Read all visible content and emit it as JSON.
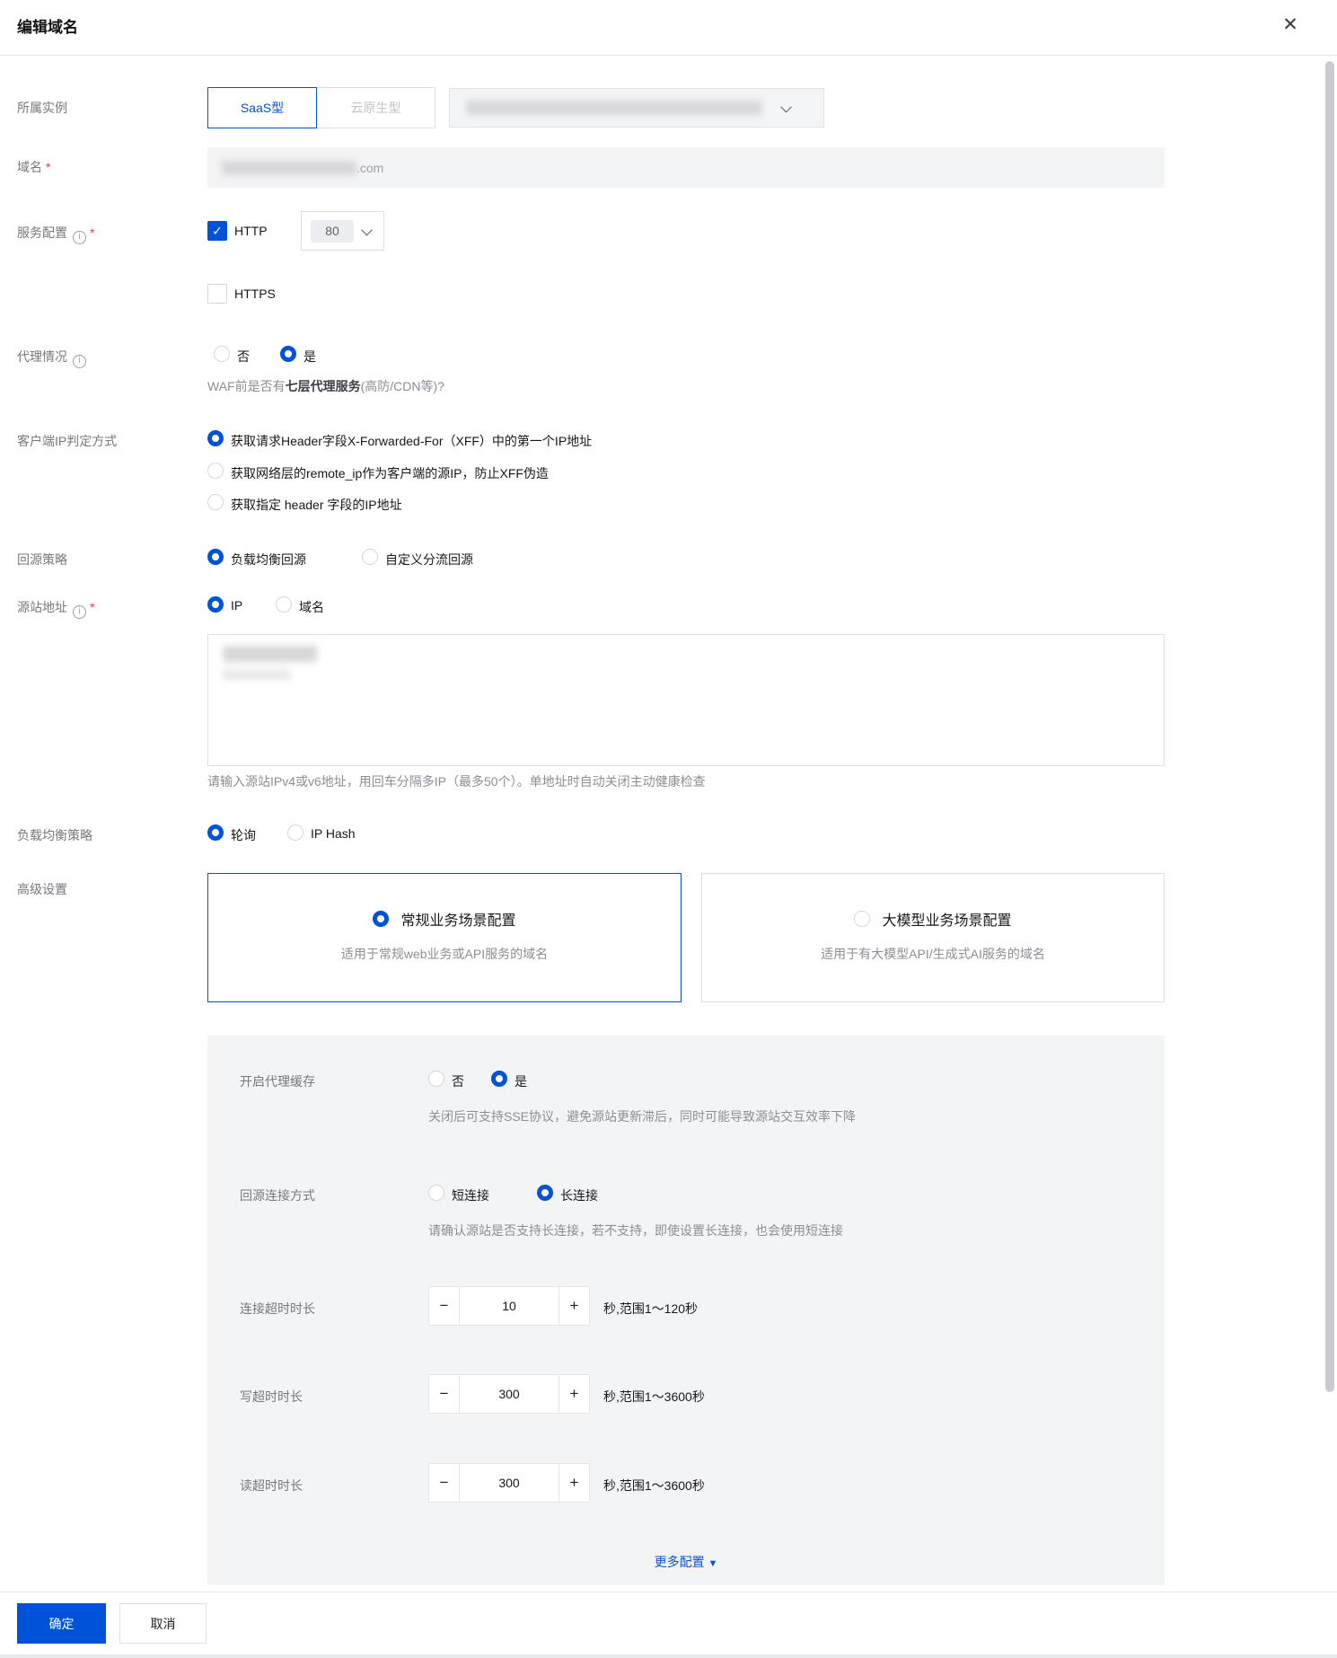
{
  "header": {
    "title": "编辑域名"
  },
  "icons": {
    "close": "✕",
    "check": "✓",
    "info": "i",
    "minus": "−",
    "plus": "+",
    "caret_down": "▼"
  },
  "required_mark": "*",
  "colors": {
    "primary": "#0052d9",
    "danger": "#e54545",
    "panel_bg": "#f3f4f6"
  },
  "form": {
    "instance": {
      "label": "所属实例",
      "tabs": [
        {
          "label": "SaaS型"
        },
        {
          "label": "云原生型"
        }
      ]
    },
    "domain": {
      "label": "域名",
      "suffix": ".com"
    },
    "service": {
      "label": "服务配置",
      "http": {
        "label": "HTTP",
        "port": "80"
      },
      "https": {
        "label": "HTTPS"
      }
    },
    "proxy": {
      "label": "代理情况",
      "no": "否",
      "yes": "是",
      "helper_prefix": "WAF前是否有",
      "helper_bold": "七层代理服务",
      "helper_suffix": "(高防/CDN等)?"
    },
    "client_ip": {
      "label": "客户端IP判定方式",
      "options": [
        "获取请求Header字段X-Forwarded-For（XFF）中的第一个IP地址",
        "获取网络层的remote_ip作为客户端的源IP，防止XFF伪造",
        "获取指定 header 字段的IP地址"
      ]
    },
    "origin_policy": {
      "label": "回源策略",
      "options": [
        "负载均衡回源",
        "自定义分流回源"
      ]
    },
    "origin_addr": {
      "label": "源站地址",
      "options": [
        "IP",
        "域名"
      ],
      "helper": "请输入源站IPv4或v6地址，用回车分隔多IP（最多50个）。单地址时自动关闭主动健康检查"
    },
    "lb": {
      "label": "负载均衡策略",
      "options": [
        "轮询",
        "IP Hash"
      ]
    },
    "advanced": {
      "label": "高级设置",
      "cards": [
        {
          "title": "常规业务场景配置",
          "desc": "适用于常规web业务或API服务的域名"
        },
        {
          "title": "大模型业务场景配置",
          "desc": "适用于有大模型API/生成式AI服务的域名"
        }
      ]
    },
    "panel": {
      "proxy_cache": {
        "label": "开启代理缓存",
        "no": "否",
        "yes": "是",
        "helper": "关闭后可支持SSE协议，避免源站更新滞后，同时可能导致源站交互效率下降"
      },
      "conn": {
        "label": "回源连接方式",
        "short": "短连接",
        "long": "长连接",
        "helper": "请确认源站是否支持长连接，若不支持，即使设置长连接，也会使用短连接"
      },
      "timeouts": [
        {
          "label": "连接超时时长",
          "value": "10",
          "range": "秒,范围1～120秒"
        },
        {
          "label": "写超时时长",
          "value": "300",
          "range": "秒,范围1～3600秒"
        },
        {
          "label": "读超时时长",
          "value": "300",
          "range": "秒,范围1～3600秒"
        }
      ],
      "more": "更多配置"
    },
    "footer": {
      "confirm": "确定",
      "cancel": "取消"
    }
  }
}
